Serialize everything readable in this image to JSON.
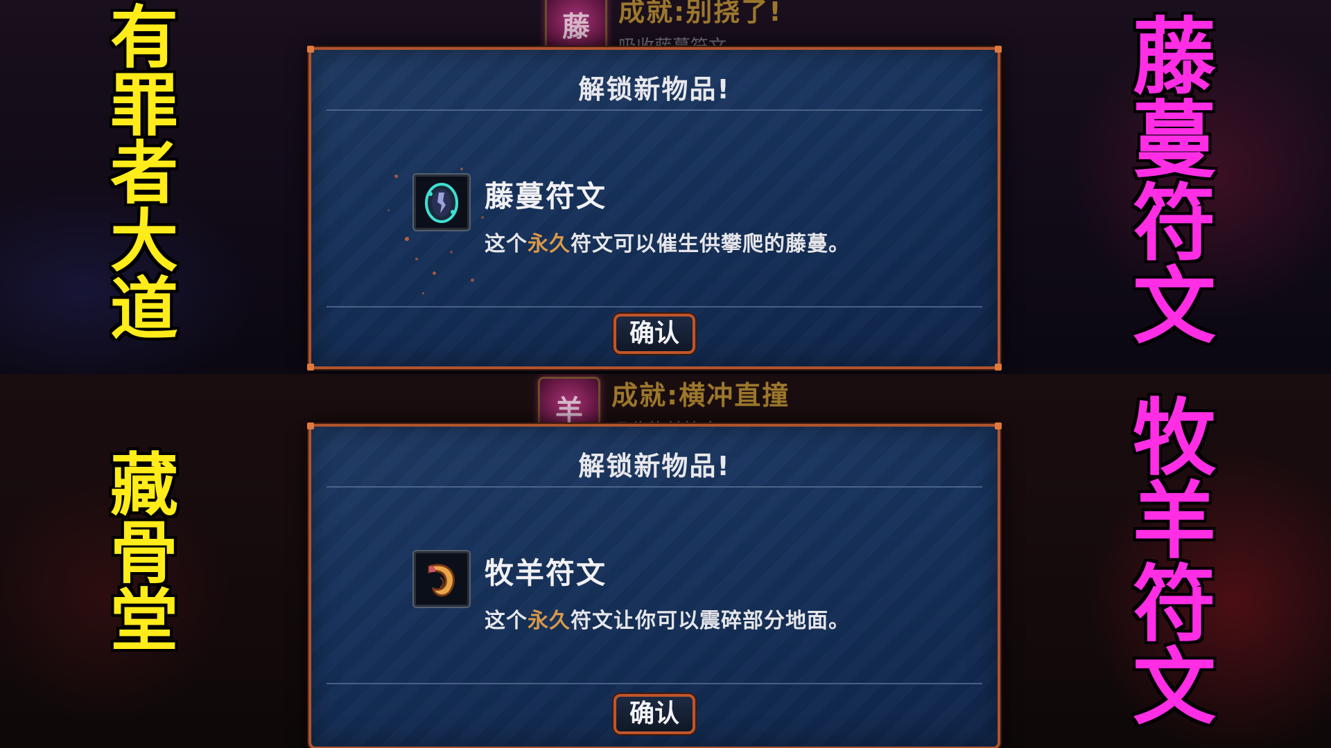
{
  "top": {
    "toast": {
      "title": "成就:别挠了!",
      "subtitle": "吸收藤蔓符文",
      "badge_glyph": "藤"
    },
    "dialog": {
      "title": "解锁新物品!",
      "item_name": "藤蔓符文",
      "desc_before": "这个",
      "desc_highlight": "永久",
      "desc_after": "符文可以催生供攀爬的藤蔓。",
      "confirm_label": "确认",
      "icon": "vine-rune-icon"
    },
    "left_caption": [
      "有",
      "罪",
      "者",
      "大",
      "道"
    ],
    "right_caption": [
      "藤",
      "蔓",
      "符",
      "文"
    ]
  },
  "bottom": {
    "toast": {
      "title": "成就:横冲直撞",
      "subtitle": "吸收牧羊符文",
      "badge_glyph": "羊"
    },
    "dialog": {
      "title": "解锁新物品!",
      "item_name": "牧羊符文",
      "desc_before": "这个",
      "desc_highlight": "永久",
      "desc_after": "符文让你可以震碎部分地面。",
      "confirm_label": "确认",
      "icon": "ram-horn-rune-icon"
    },
    "left_caption": [
      "藏",
      "骨",
      "堂"
    ],
    "right_caption": [
      "牧",
      "羊",
      "符",
      "文"
    ]
  },
  "colors": {
    "caption_left": "#ffec1a",
    "caption_right": "#ff2ee5",
    "highlight": "#d8994a",
    "dialog_border": "#b0542c",
    "dialog_bg": "#16315a"
  }
}
